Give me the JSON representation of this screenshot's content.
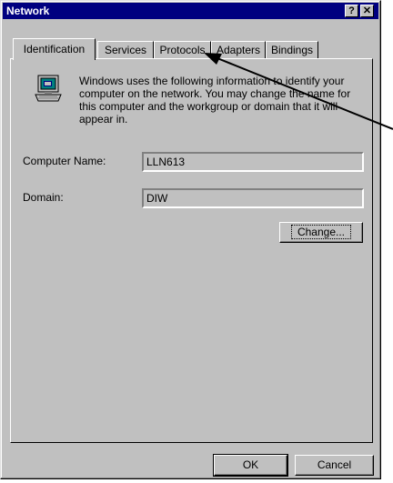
{
  "window": {
    "title": "Network"
  },
  "titlebar_buttons": {
    "help": "?",
    "close": "✕"
  },
  "tabs": [
    {
      "label": "Identification",
      "active": true
    },
    {
      "label": "Services",
      "active": false
    },
    {
      "label": "Protocols",
      "active": false
    },
    {
      "label": "Adapters",
      "active": false
    },
    {
      "label": "Bindings",
      "active": false
    }
  ],
  "identification": {
    "icon": "computer-icon",
    "description": "Windows uses the following information to identify your computer on the network.  You may change the name for this computer and the workgroup or domain that it will appear in.",
    "computer_name_label": "Computer Name:",
    "computer_name_value": "LLN613",
    "domain_label": "Domain:",
    "domain_value": "DIW",
    "change_button": "Change..."
  },
  "footer": {
    "ok_label": "OK",
    "cancel_label": "Cancel"
  },
  "colors": {
    "title_bar": "#000080",
    "face": "#c0c0c0"
  }
}
